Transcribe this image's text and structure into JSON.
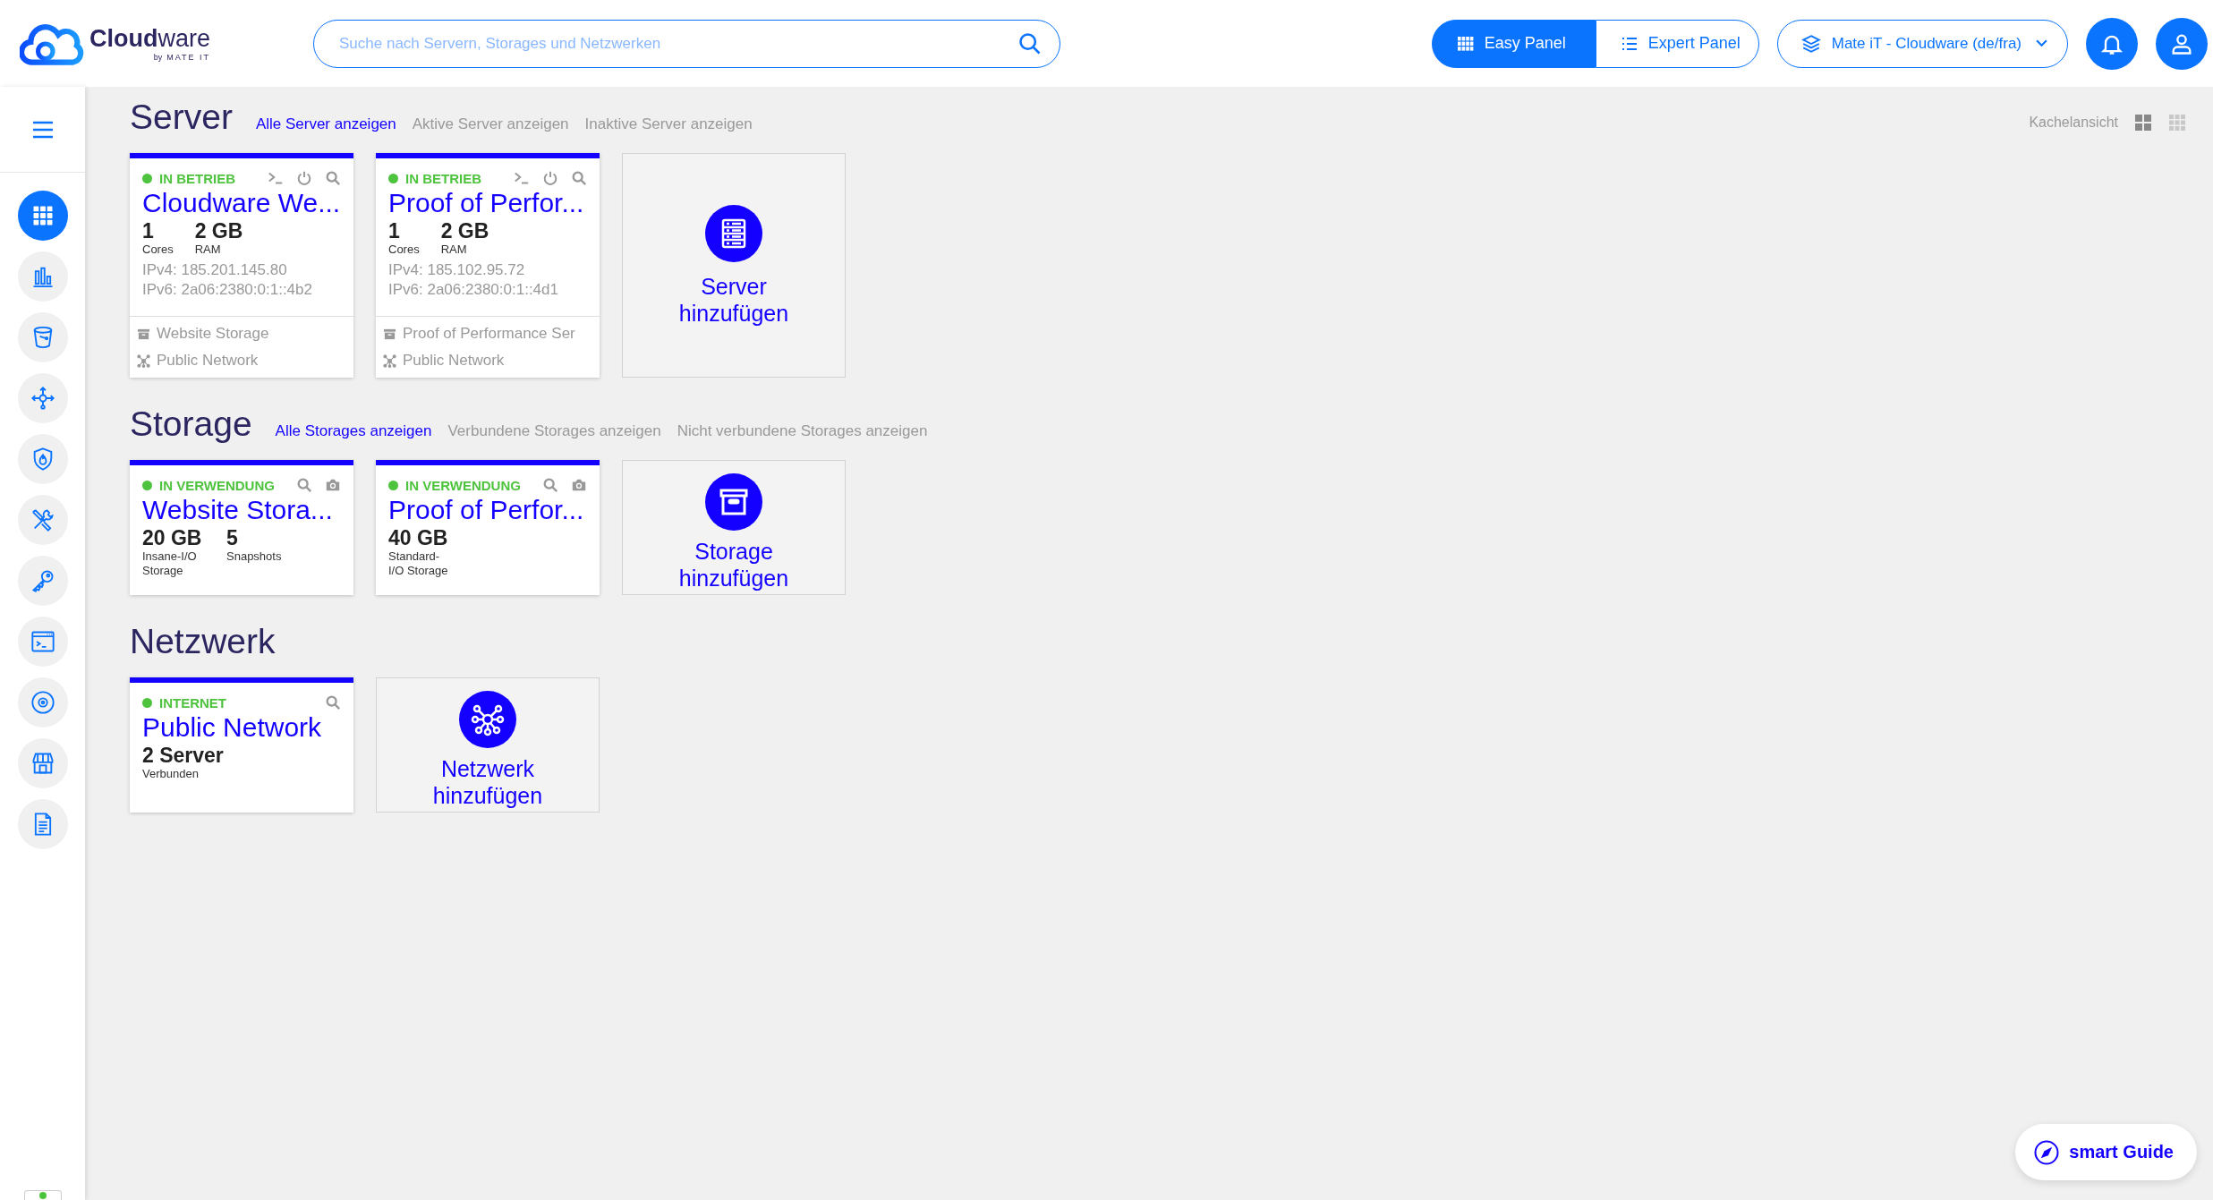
{
  "header": {
    "logo": {
      "name": "**Cloud**ware",
      "byline": "by",
      "brand": "MATE IT"
    },
    "search": {
      "placeholder": "Suche nach Servern, Storages und Netzwerken"
    },
    "panel_toggle": [
      {
        "label": "Easy Panel",
        "selected": true
      },
      {
        "label": "Expert Panel",
        "selected": false
      }
    ],
    "tenant": {
      "label": "Mate iT - Cloudware (de/fra)"
    }
  },
  "sidebar": {
    "items": [
      {
        "kind": "dashboard",
        "selected": true
      },
      {
        "kind": "stats",
        "selected": false
      },
      {
        "kind": "storage",
        "selected": false
      },
      {
        "kind": "network",
        "selected": false
      },
      {
        "kind": "firewall",
        "selected": false
      },
      {
        "kind": "tools",
        "selected": false
      },
      {
        "kind": "key",
        "selected": false
      },
      {
        "kind": "console",
        "selected": false
      },
      {
        "kind": "disc",
        "selected": false
      },
      {
        "kind": "store",
        "selected": false
      },
      {
        "kind": "document",
        "selected": false
      }
    ]
  },
  "view": {
    "label": "Kachelansicht",
    "options": [
      {
        "kind": "large-grid",
        "selected": true
      },
      {
        "kind": "small-grid",
        "selected": false
      }
    ]
  },
  "sections": [
    {
      "kind": "server",
      "title": "Server",
      "filters": [
        {
          "label": "Alle Server anzeigen",
          "selected": true
        },
        {
          "label": "Aktive Server anzeigen",
          "selected": false
        },
        {
          "label": "Inaktive Server anzeigen",
          "selected": false
        }
      ],
      "cards": [
        {
          "status": "IN BETRIEB",
          "name": "Cloudware We...",
          "stats": [
            {
              "value": "1",
              "label": "Cores"
            },
            {
              "value": "2 GB",
              "label": "RAM"
            }
          ],
          "details": [
            "IPv4: 185.201.145.80",
            "IPv6: 2a06:2380:0:1::4b2"
          ],
          "links": [
            {
              "kind": "storage",
              "label": "Website Storage"
            },
            {
              "kind": "network",
              "label": "Public Network"
            }
          ]
        },
        {
          "status": "IN BETRIEB",
          "name": "Proof of Perfor...",
          "stats": [
            {
              "value": "1",
              "label": "Cores"
            },
            {
              "value": "2 GB",
              "label": "RAM"
            }
          ],
          "details": [
            "IPv4: 185.102.95.72",
            "IPv6: 2a06:2380:0:1::4d1"
          ],
          "links": [
            {
              "kind": "storage",
              "label": "Proof of Performance Ser"
            },
            {
              "kind": "network",
              "label": "Public Network"
            }
          ]
        }
      ],
      "add": "Server hinzufügen"
    },
    {
      "kind": "storage",
      "title": "Storage",
      "filters": [
        {
          "label": "Alle Storages anzeigen",
          "selected": true
        },
        {
          "label": "Verbundene Storages anzeigen",
          "selected": false
        },
        {
          "label": "Nicht verbundene Storages anzeigen",
          "selected": false
        }
      ],
      "cards": [
        {
          "status": "IN VERWENDUNG",
          "name": "Website Stora...",
          "stats": [
            {
              "value": "20 GB",
              "label": "Insane-I/O Storage"
            },
            {
              "value": "5",
              "label": "Snapshots"
            }
          ]
        },
        {
          "status": "IN VERWENDUNG",
          "name": "Proof of Perfor...",
          "stats": [
            {
              "value": "40 GB",
              "label": "Standard-I/O Storage"
            }
          ]
        }
      ],
      "add": "Storage hinzufügen"
    },
    {
      "kind": "network",
      "title": "Netzwerk",
      "cards": [
        {
          "status": "INTERNET",
          "name": "Public Network",
          "stats": [
            {
              "value": "2 Server",
              "label": "Verbunden"
            }
          ]
        }
      ],
      "add": "Netzwerk hinzufügen"
    }
  ],
  "smart_guide": {
    "label": "smart Guide"
  }
}
